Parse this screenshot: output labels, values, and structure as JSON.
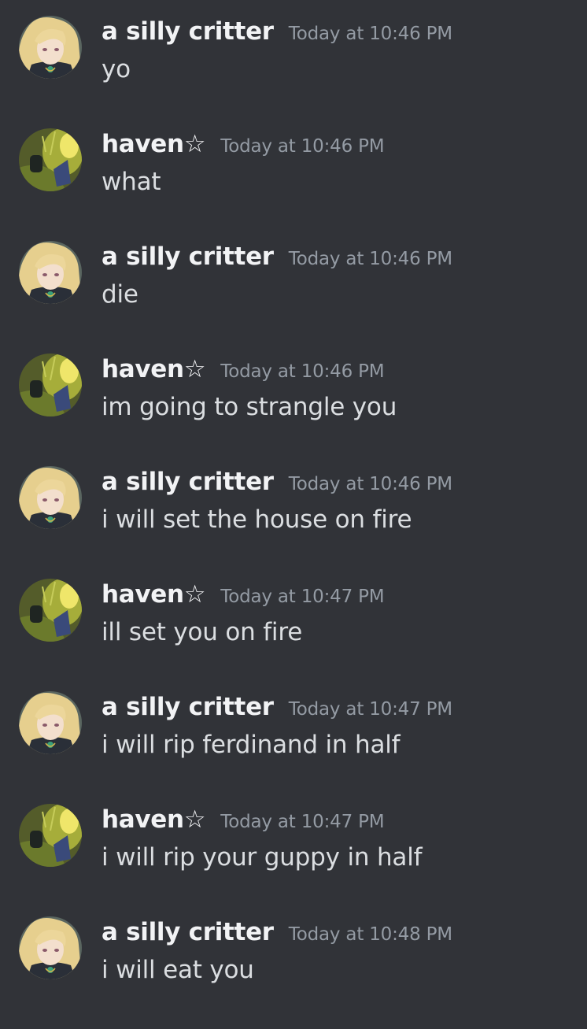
{
  "messages": [
    {
      "author": "a silly critter",
      "avatar": "critter-avatar-icon",
      "timestamp": "Today at 10:46 PM",
      "text": "yo"
    },
    {
      "author": "haven☆",
      "avatar": "haven-avatar-icon",
      "timestamp": "Today at 10:46 PM",
      "text": "what"
    },
    {
      "author": "a silly critter",
      "avatar": "critter-avatar-icon",
      "timestamp": "Today at 10:46 PM",
      "text": "die"
    },
    {
      "author": "haven☆",
      "avatar": "haven-avatar-icon",
      "timestamp": "Today at 10:46 PM",
      "text": "im going to strangle you"
    },
    {
      "author": "a silly critter",
      "avatar": "critter-avatar-icon",
      "timestamp": "Today at 10:46 PM",
      "text": "i will set the house on fire"
    },
    {
      "author": "haven☆",
      "avatar": "haven-avatar-icon",
      "timestamp": "Today at 10:47 PM",
      "text": "ill set you on fire"
    },
    {
      "author": "a silly critter",
      "avatar": "critter-avatar-icon",
      "timestamp": "Today at 10:47 PM",
      "text": "i will rip ferdinand in half"
    },
    {
      "author": "haven☆",
      "avatar": "haven-avatar-icon",
      "timestamp": "Today at 10:47 PM",
      "text": "i will rip your guppy in half"
    },
    {
      "author": "a silly critter",
      "avatar": "critter-avatar-icon",
      "timestamp": "Today at 10:48 PM",
      "text": "i will eat you"
    }
  ],
  "colors": {
    "background": "#313338",
    "username": "#f2f3f5",
    "timestamp": "#949ba4",
    "message_text": "#dbdee1"
  }
}
